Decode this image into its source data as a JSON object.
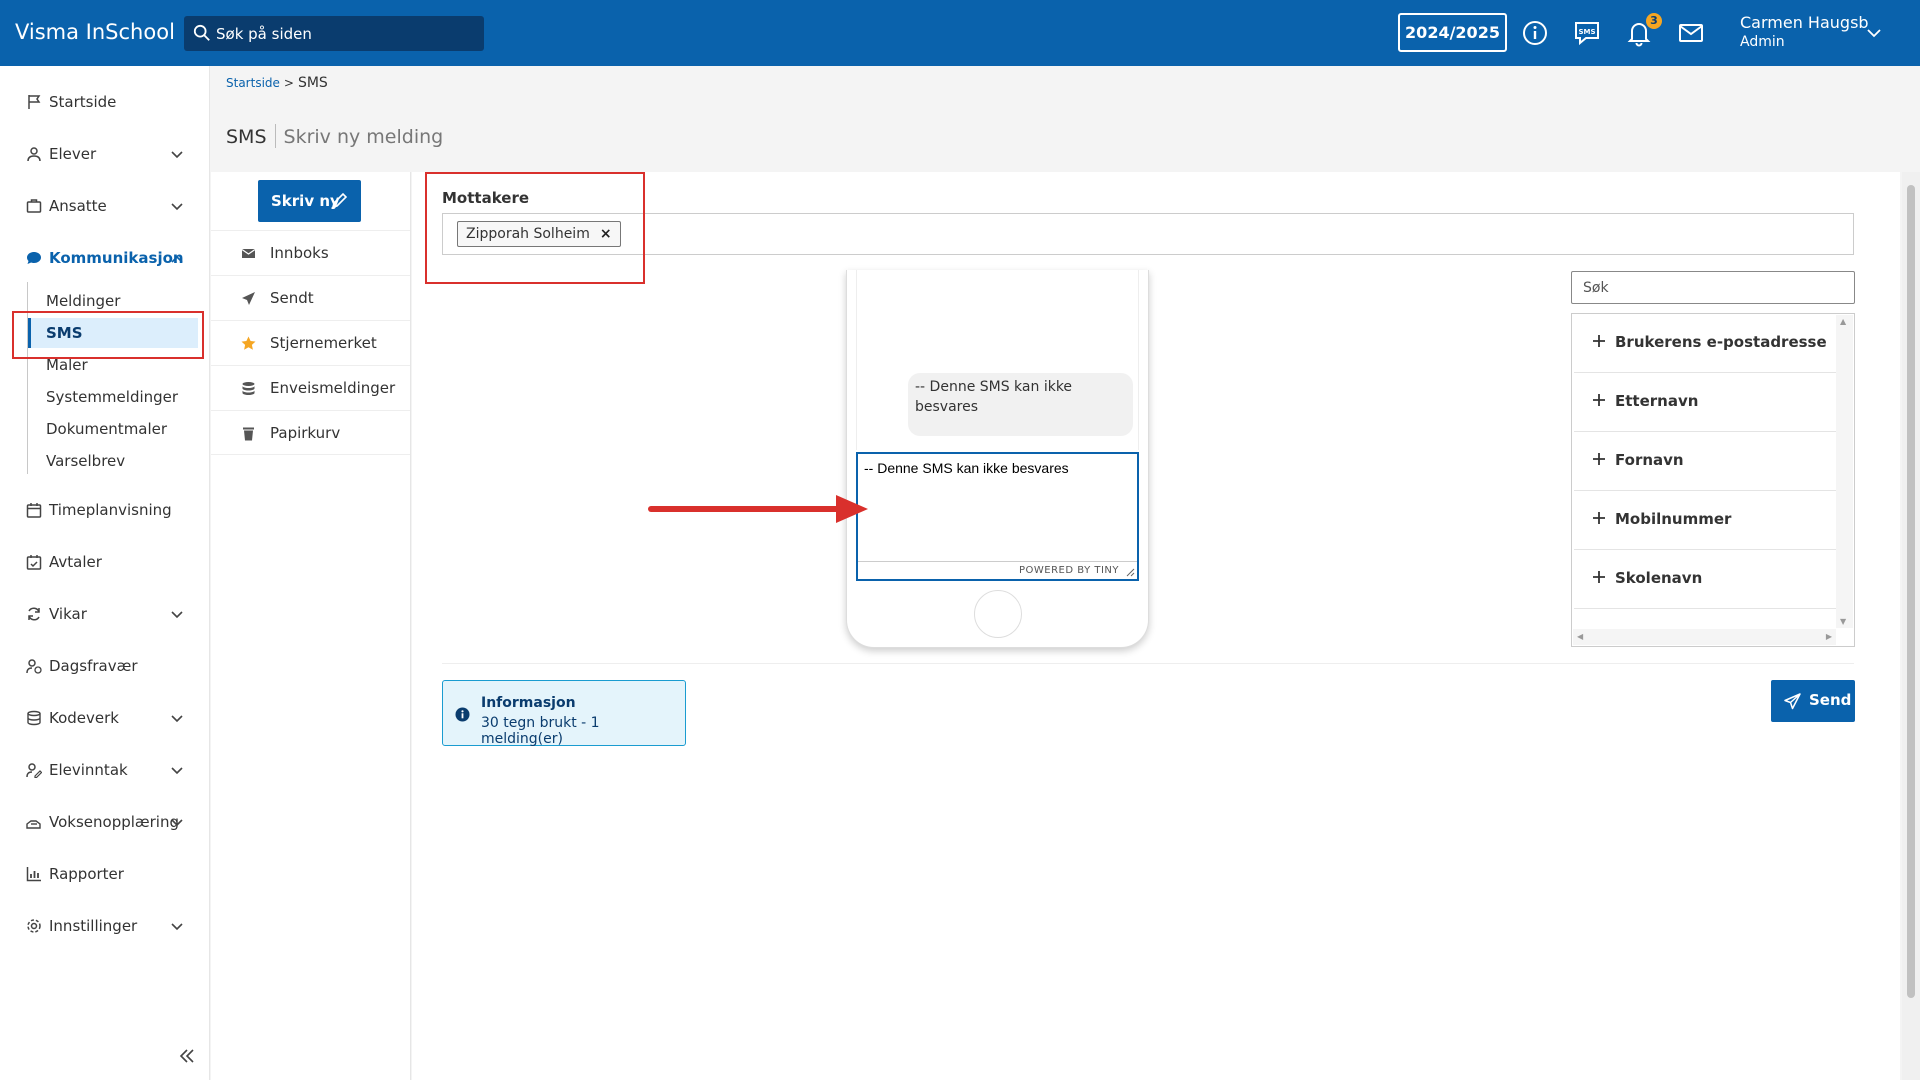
{
  "header": {
    "brand": "Visma InSchool",
    "search_placeholder": "Søk på siden",
    "school_year": "2024/2025",
    "notification_count": "3",
    "user_name": "Carmen Haugsb",
    "user_role": "Admin"
  },
  "sidebar": {
    "items": [
      {
        "label": "Startside"
      },
      {
        "label": "Elever"
      },
      {
        "label": "Ansatte"
      },
      {
        "label": "Kommunikasjon"
      },
      {
        "label": "Timeplanvisning"
      },
      {
        "label": "Avtaler"
      },
      {
        "label": "Vikar"
      },
      {
        "label": "Dagsfravær"
      },
      {
        "label": "Kodeverk"
      },
      {
        "label": "Elevinntak"
      },
      {
        "label": "Voksenopplæring"
      },
      {
        "label": "Rapporter"
      },
      {
        "label": "Innstillinger"
      }
    ],
    "subitems": [
      {
        "label": "Meldinger"
      },
      {
        "label": "SMS"
      },
      {
        "label": "Maler"
      },
      {
        "label": "Systemmeldinger"
      },
      {
        "label": "Dokumentmaler"
      },
      {
        "label": "Varselbrev"
      }
    ]
  },
  "breadcrumb": {
    "home": "Startside",
    "sep": ">",
    "current": "SMS"
  },
  "page": {
    "title": "SMS",
    "subtitle": "Skriv ny melding"
  },
  "midnav": {
    "write_label": "Skriv ny",
    "items": [
      {
        "label": "Innboks"
      },
      {
        "label": "Sendt"
      },
      {
        "label": "Stjernemerket"
      },
      {
        "label": "Enveismeldinger"
      },
      {
        "label": "Papirkurv"
      }
    ]
  },
  "recipients": {
    "label": "Mottakere",
    "chips": [
      {
        "name": "Zipporah Solheim",
        "remove": "×"
      }
    ]
  },
  "phone": {
    "preview_text": "-- Denne SMS kan ikke besvares",
    "editor_text": "-- Denne SMS kan ikke besvares",
    "powered_by": "POWERED BY TINY"
  },
  "fields": {
    "search_placeholder": "Søk",
    "items": [
      {
        "label": "Brukerens e-postadresse"
      },
      {
        "label": "Etternavn"
      },
      {
        "label": "Fornavn"
      },
      {
        "label": "Mobilnummer"
      },
      {
        "label": "Skolenavn"
      }
    ]
  },
  "info": {
    "title": "Informasjon",
    "text": "30 tegn brukt - 1 melding(er)"
  },
  "send_label": "Send",
  "colors": {
    "brand": "#0a62ac",
    "annotation": "#d9302c",
    "badge": "#f5a623"
  },
  "icons": {
    "search": "search-icon",
    "info": "info-icon",
    "sms": "sms-icon",
    "bell": "bell-icon",
    "mail": "mail-icon",
    "flag": "flag-icon",
    "student": "student-icon",
    "staff": "staff-icon",
    "chat": "chat-icon",
    "calendar": "calendar-icon",
    "check-calendar": "calendar-check-icon",
    "refresh": "refresh-icon",
    "user-clock": "user-clock-icon",
    "database": "database-icon",
    "user-edit": "user-edit-icon",
    "hand": "hand-icon",
    "chart": "chart-icon",
    "gear": "gear-icon",
    "pencil": "pencil-icon",
    "envelope": "envelope-icon",
    "send": "send-icon",
    "star": "star-icon",
    "layers": "layers-icon",
    "trash": "trash-icon",
    "plus": "plus-icon",
    "close": "close-icon",
    "collapse": "double-chevron-left-icon"
  }
}
